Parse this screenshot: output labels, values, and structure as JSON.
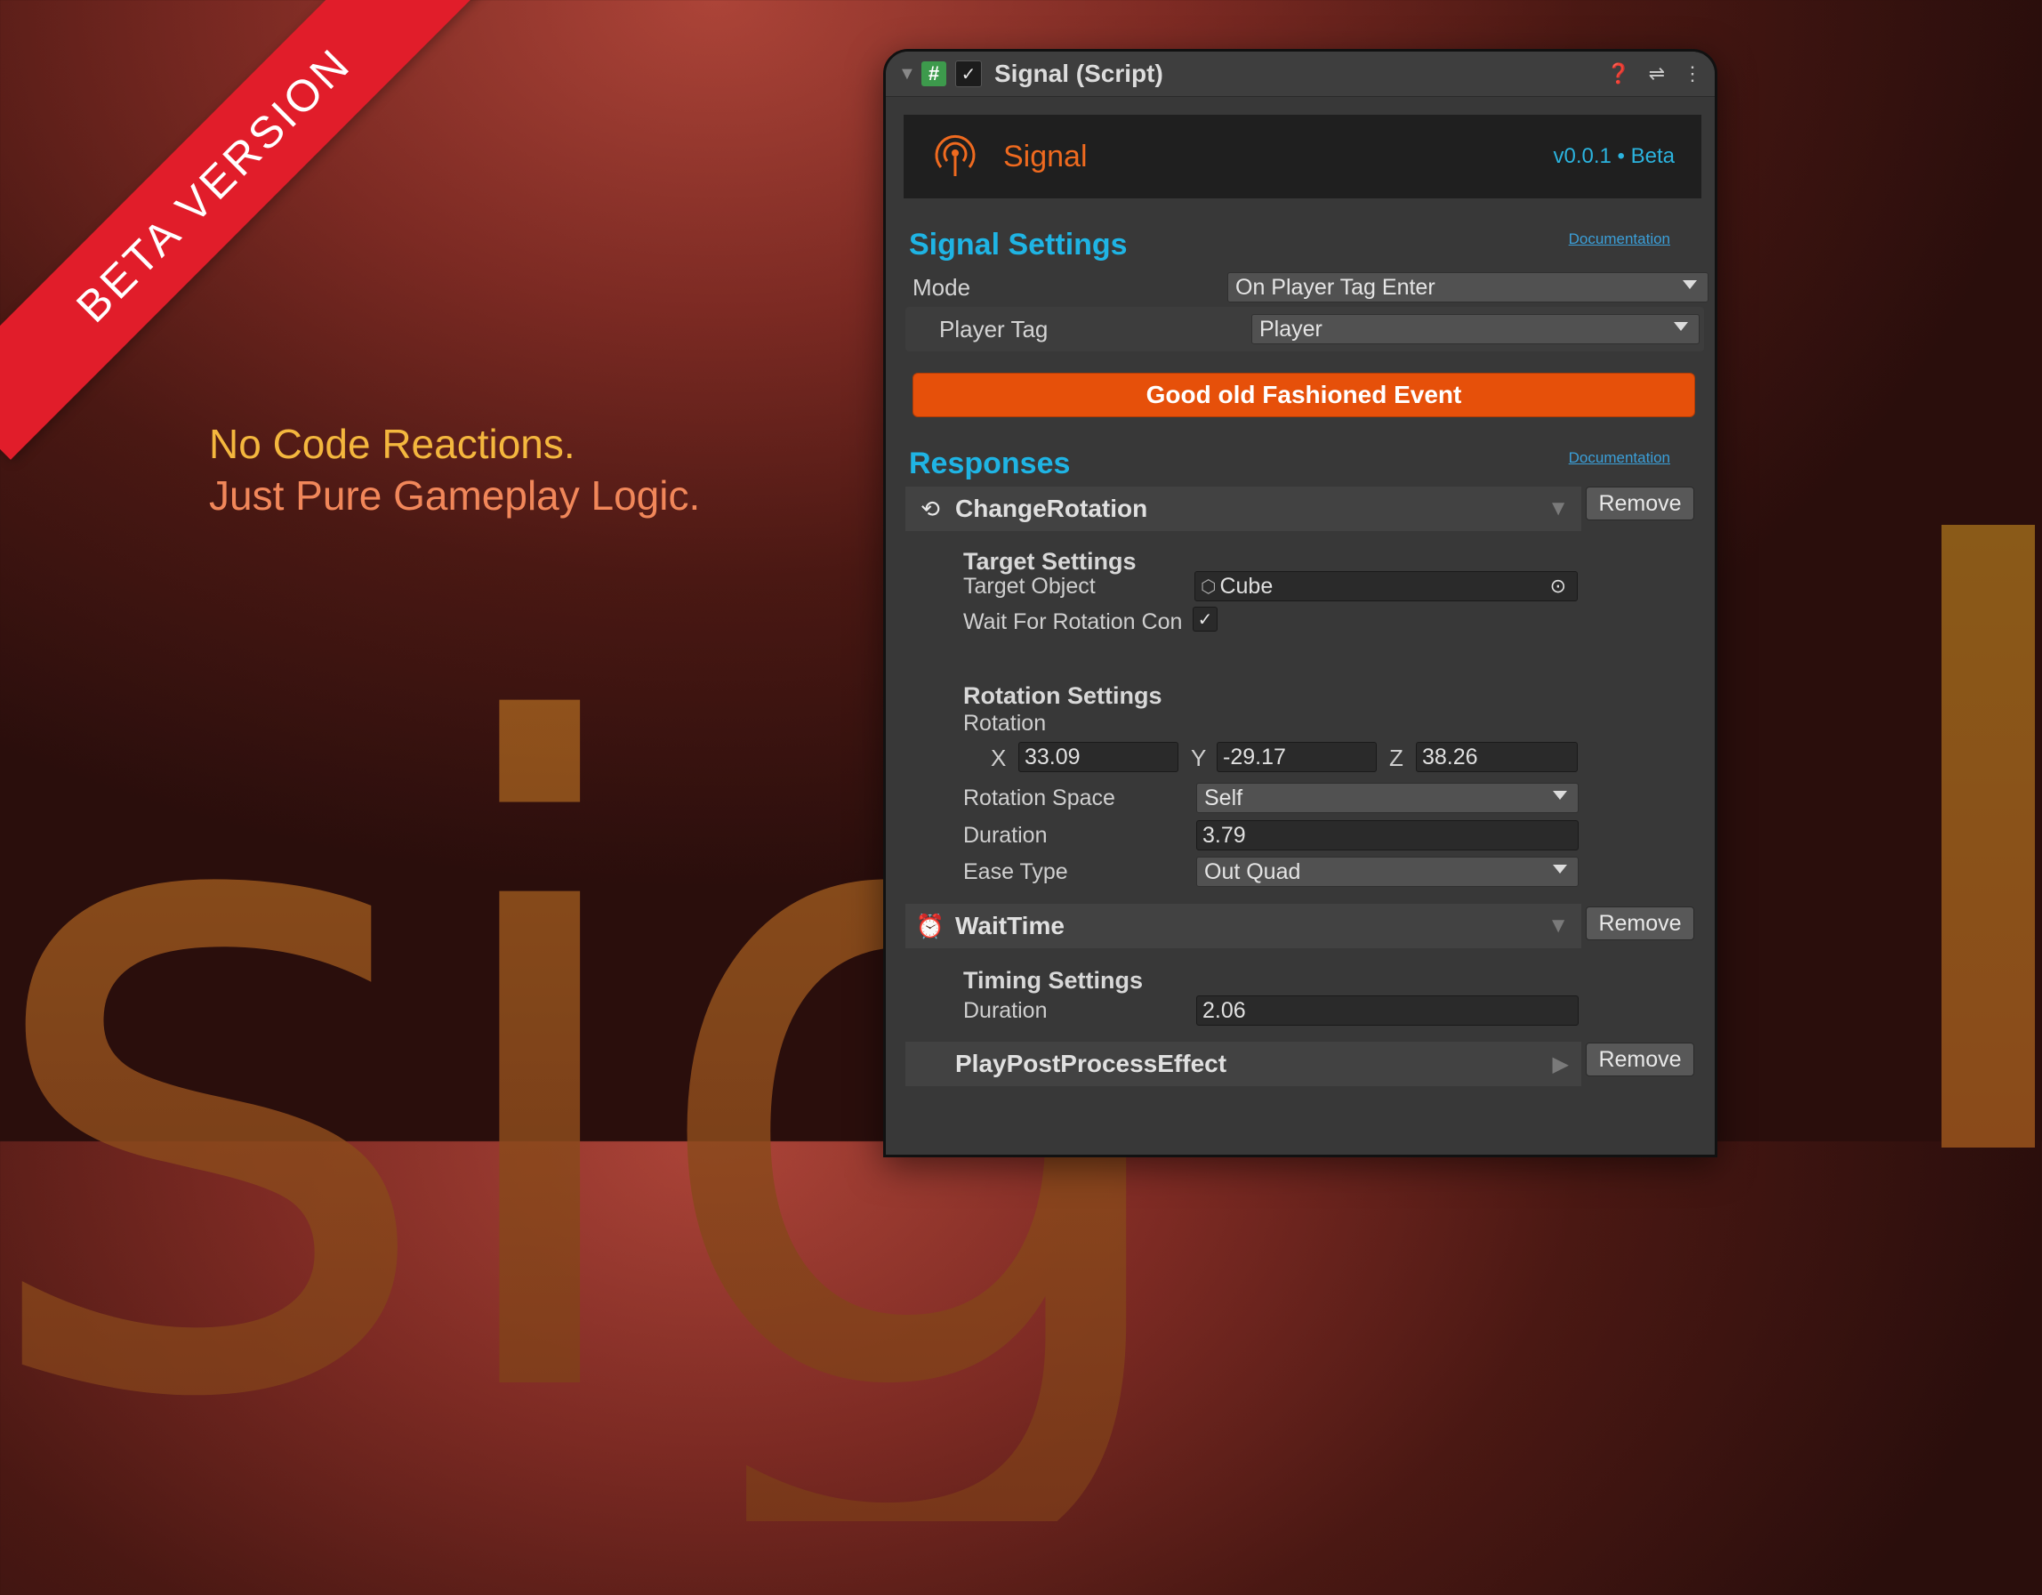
{
  "banner": {
    "ribbon": "BETA VERSION",
    "tagline_1": "No Code Reactions.",
    "tagline_2": "Just Pure Gameplay Logic.",
    "bg_word": "sig"
  },
  "inspector": {
    "title": "Signal (Script)",
    "component_name": "Signal",
    "version": "v0.0.1 • Beta",
    "signal_settings": {
      "title": "Signal Settings",
      "doc_link": "Documentation",
      "mode_label": "Mode",
      "mode_value": "On Player Tag Enter",
      "player_tag_label": "Player Tag",
      "player_tag_value": "Player"
    },
    "event_button": "Good old Fashioned Event",
    "responses": {
      "title": "Responses",
      "doc_link": "Documentation",
      "remove_label": "Remove",
      "change_rotation": {
        "name": "ChangeRotation",
        "target_settings": "Target Settings",
        "target_object_label": "Target Object",
        "target_object_value": "Cube",
        "wait_label": "Wait For Rotation Con",
        "rotation_settings": "Rotation Settings",
        "rotation_label": "Rotation",
        "x_label": "X",
        "x": "33.09",
        "y_label": "Y",
        "y": "-29.17",
        "z_label": "Z",
        "z": "38.26",
        "rotation_space_label": "Rotation Space",
        "rotation_space_value": "Self",
        "duration_label": "Duration",
        "duration_value": "3.79",
        "ease_label": "Ease Type",
        "ease_value": "Out Quad"
      },
      "wait_time": {
        "name": "WaitTime",
        "timing_settings": "Timing Settings",
        "duration_label": "Duration",
        "duration_value": "2.06"
      },
      "post_process": {
        "name": "PlayPostProcessEffect"
      }
    }
  },
  "colors": {
    "accent_orange": "#e6500a",
    "accent_cyan": "#1fb4e4",
    "ribbon_red": "#e11d2a"
  }
}
